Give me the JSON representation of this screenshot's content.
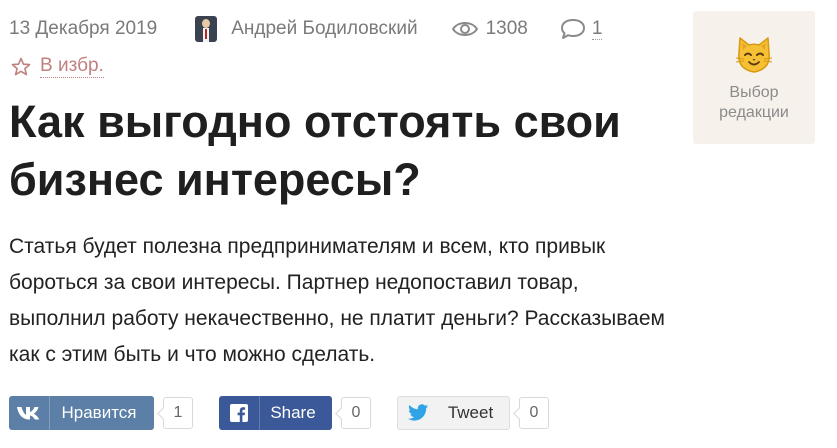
{
  "meta": {
    "date": "13 Декабря 2019",
    "author": "Андрей Бодиловский",
    "views": "1308",
    "comments": "1"
  },
  "favorite": {
    "label": "В избр."
  },
  "badge": {
    "line1": "Выбор",
    "line2": "редакции"
  },
  "article": {
    "title": "Как выгодно отстоять свои бизнес интересы?",
    "lead": "Статья будет полезна предпринимателям и всем, кто привык бороться за свои интересы. Партнер недопоставил товар, выполнил работу некачественно, не платит деньги? Рассказываем как с этим быть и что можно сделать."
  },
  "share": {
    "vk": {
      "label": "Нравится",
      "count": "1"
    },
    "facebook": {
      "label": "Share",
      "count": "0"
    },
    "twitter": {
      "label": "Tweet",
      "count": "0"
    }
  },
  "colors": {
    "favorite_accent": "#c0807e",
    "vk": "#5b7fa6",
    "facebook": "#3b5998",
    "twitter_icon": "#2fa3e6",
    "badge_bg": "#f6f1ea"
  },
  "icons": [
    "author-avatar",
    "eye-icon",
    "comment-icon",
    "star-icon",
    "cat-face-icon",
    "vk-icon",
    "facebook-icon",
    "twitter-icon"
  ]
}
